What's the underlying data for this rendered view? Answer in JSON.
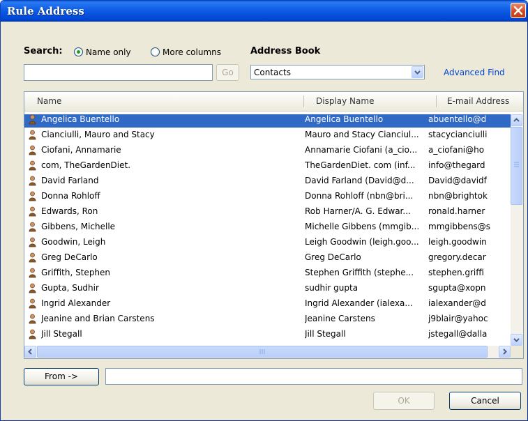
{
  "window": {
    "title": "Rule Address"
  },
  "search": {
    "label": "Search:",
    "name_only_label": "Name only",
    "more_columns_label": "More columns",
    "input_value": "",
    "go_label": "Go"
  },
  "address_book": {
    "label": "Address Book",
    "selected": "Contacts",
    "advanced_find": "Advanced Find"
  },
  "columns": [
    "Name",
    "Display Name",
    "E-mail Address"
  ],
  "contacts": [
    {
      "name": "Angelica Buentello",
      "display": "Angelica Buentello",
      "email": "abuentello@d",
      "selected": true
    },
    {
      "name": "Cianciulli, Mauro and Stacy",
      "display": "Mauro and Stacy Cianciul...",
      "email": "stacycianciulli",
      "selected": false
    },
    {
      "name": "Ciofani, Annamarie",
      "display": "Annamarie Ciofani (a_cio...",
      "email": "a_ciofani@ho",
      "selected": false
    },
    {
      "name": "com, TheGardenDiet.",
      "display": "TheGardenDiet. com (inf...",
      "email": "info@thegard",
      "selected": false
    },
    {
      "name": "David Farland",
      "display": "David Farland (David@d...",
      "email": "David@davidf",
      "selected": false
    },
    {
      "name": "Donna Rohloff",
      "display": "Donna Rohloff (nbn@bri...",
      "email": "nbn@brightok",
      "selected": false
    },
    {
      "name": "Edwards, Ron",
      "display": "Rob Harner/A. G. Edwar...",
      "email": "ronald.harner",
      "selected": false
    },
    {
      "name": "Gibbens, Michelle",
      "display": "Michelle Gibbens (mmgib...",
      "email": "mmgibbens@s",
      "selected": false
    },
    {
      "name": "Goodwin, Leigh",
      "display": "Leigh Goodwin (leigh.goo...",
      "email": "leigh.goodwin",
      "selected": false
    },
    {
      "name": "Greg DeCarlo",
      "display": "Greg DeCarlo",
      "email": "gregory.decar",
      "selected": false
    },
    {
      "name": "Griffith, Stephen",
      "display": "Stephen Griffith (stephe...",
      "email": "stephen.griffi",
      "selected": false
    },
    {
      "name": "Gupta, Sudhir",
      "display": "sudhir gupta",
      "email": "sgupta@xopn",
      "selected": false
    },
    {
      "name": "Ingrid Alexander",
      "display": "Ingrid Alexander (ialexa...",
      "email": "ialexander@d",
      "selected": false
    },
    {
      "name": "Jeanine and Brian Carstens",
      "display": "Jeanine Carstens",
      "email": "j9blair@yahoc",
      "selected": false
    },
    {
      "name": "Jill Stegall",
      "display": "Jill Stegall",
      "email": "jstegall@dalla",
      "selected": false
    }
  ],
  "from_button": "From ->",
  "from_value": "",
  "ok_label": "OK",
  "cancel_label": "Cancel",
  "colors": {
    "titlebar": "#0046d5",
    "selection": "#316ac5",
    "link": "#0046d5"
  }
}
